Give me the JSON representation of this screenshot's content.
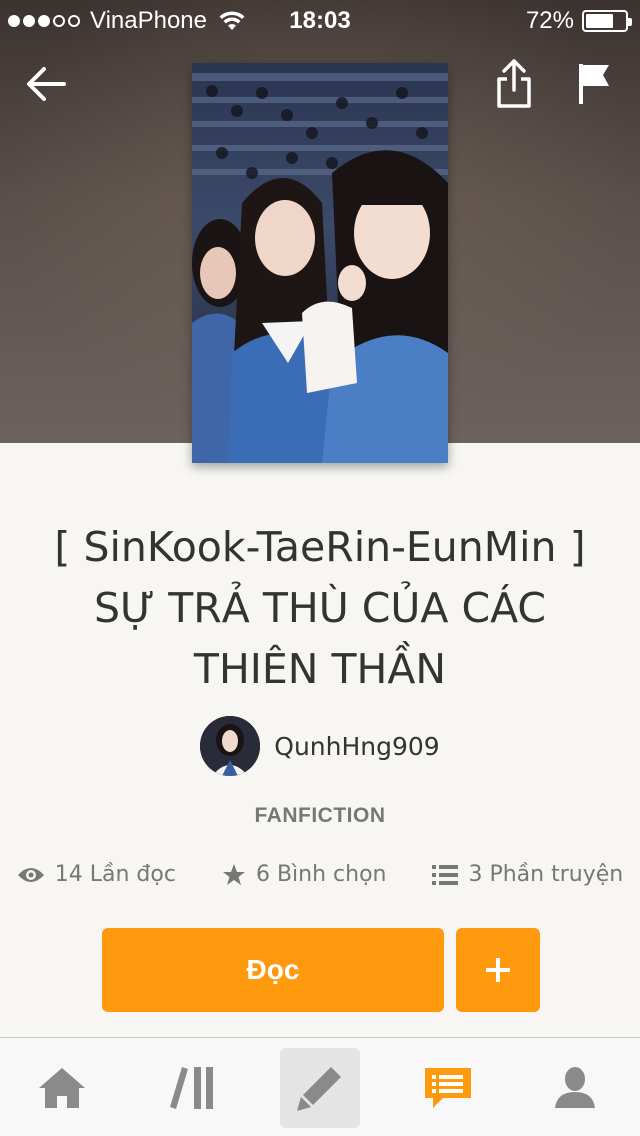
{
  "status_bar": {
    "carrier": "VinaPhone",
    "time": "18:03",
    "battery_percent": "72%",
    "battery_level": 0.72,
    "signal_bars_filled": 3,
    "signal_bars_total": 5
  },
  "header": {
    "back_icon": "arrow-left-icon",
    "share_icon": "share-icon",
    "flag_icon": "flag-icon"
  },
  "story": {
    "title": "[ SinKook-TaeRin-EunMin ] SỰ TRẢ THÙ CỦA CÁC THIÊN THẦN",
    "author": "QunhHng909",
    "genre": "FANFICTION",
    "reads": "14 Lần đọc",
    "votes": "6 Bình chọn",
    "parts": "3 Phần truyện"
  },
  "actions": {
    "read_label": "Đọc",
    "add_icon": "plus-icon"
  },
  "tab_bar": {
    "items": [
      {
        "icon": "home-icon"
      },
      {
        "icon": "library-icon"
      },
      {
        "icon": "pencil-icon",
        "active": true
      },
      {
        "icon": "messages-icon"
      },
      {
        "icon": "profile-icon"
      }
    ]
  },
  "colors": {
    "accent": "#ff9a0e",
    "tab_icon": "#8a8a8a",
    "text_dark": "#333333",
    "text_muted": "#777777"
  }
}
